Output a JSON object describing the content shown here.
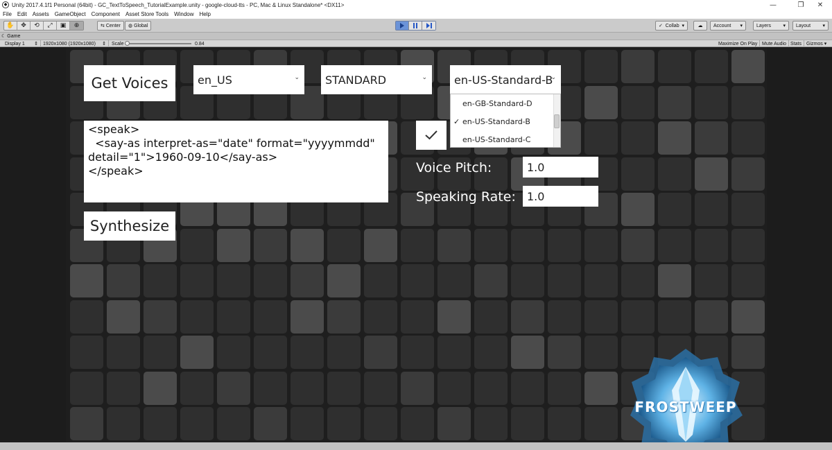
{
  "window": {
    "title": "Unity 2017.4.1f1 Personal (64bit) - GC_TextToSpeech_TutorialExample.unity - google-cloud-tts - PC, Mac & Linux Standalone* <DX11>",
    "minimize": "—",
    "restore": "❐",
    "close": "✕"
  },
  "menu": [
    "File",
    "Edit",
    "Assets",
    "GameObject",
    "Component",
    "Asset Store Tools",
    "Window",
    "Help"
  ],
  "toolbar": {
    "pivot_label": "Center",
    "space_label": "Global",
    "collab_label": "Collab",
    "account_label": "Account",
    "layers_label": "Layers",
    "layout_label": "Layout"
  },
  "game_view": {
    "tab_label": "Game",
    "display": "Display 1",
    "resolution": "1920x1080 (1920x1080)",
    "scale_label": "Scale",
    "scale_value": "0.84",
    "maximize_on_play": "Maximize On Play",
    "mute_audio": "Mute Audio",
    "stats": "Stats",
    "gizmos": "Gizmos"
  },
  "app": {
    "get_voices_button": "Get Voices",
    "language_dropdown": "en_US",
    "voice_type_dropdown": "STANDARD",
    "voice_dropdown": "en-US-Standard-B",
    "voice_options": [
      "en-GB-Standard-D",
      "en-US-Standard-B",
      "en-US-Standard-C"
    ],
    "selected_voice_index": 1,
    "ssml_text": "<speak>\n  <say-as interpret-as=\"date\" format=\"yyyymmdd\"\ndetail=\"1\">1960-09-10</say-as>\n</speak>",
    "voice_pitch_label": "Voice Pitch:",
    "voice_pitch_value": "1.0",
    "speaking_rate_label": "Speaking Rate:",
    "speaking_rate_value": "1.0",
    "synthesize_button": "Synthesize",
    "logo_text": "FROSTWEEP"
  },
  "icons": {
    "check": "check-icon",
    "chevron": "chevron-down-icon",
    "play": "play-icon",
    "pause": "pause-icon",
    "step": "step-icon"
  }
}
